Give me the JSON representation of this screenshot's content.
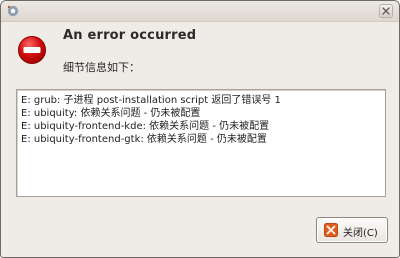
{
  "dialog": {
    "headline": "An error occurred",
    "subhead": "细节信息如下：",
    "details": [
      "E: grub: 子进程 post-installation script 返回了错误号 1",
      "E: ubiquity: 依赖关系问题 - 仍未被配置",
      "E: ubiquity-frontend-kde: 依赖关系问题 - 仍未被配置",
      "E: ubiquity-frontend-gtk: 依赖关系问题 - 仍未被配置"
    ],
    "close_button_label": "关闭(C)"
  },
  "icons": {
    "titlebar_icon": "app-icon",
    "window_close": "close-icon",
    "error": "error-icon",
    "button_close": "close-icon"
  },
  "colors": {
    "error_red": "#cc0000",
    "dialog_background": "#efebe7"
  }
}
